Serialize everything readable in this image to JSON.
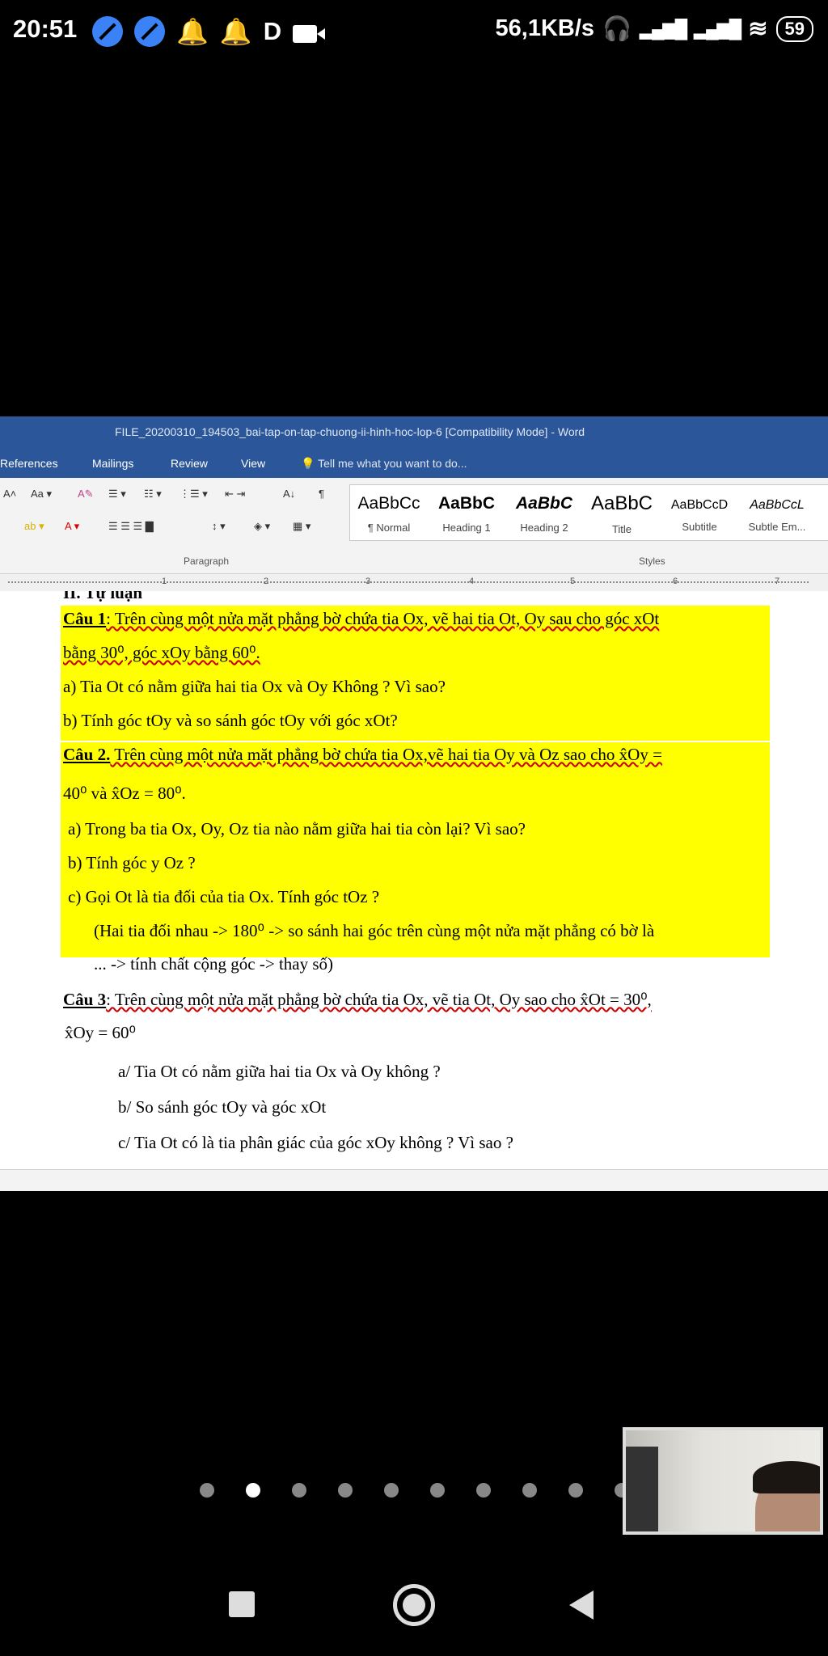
{
  "status": {
    "time": "20:51",
    "d_label": "D",
    "speed": "56,1KB/s",
    "battery": "59"
  },
  "word": {
    "title": "FILE_20200310_194503_bai-tap-on-tap-chuong-ii-hinh-hoc-lop-6 [Compatibility Mode] - Word",
    "menus": [
      "References",
      "Mailings",
      "Review",
      "View"
    ],
    "tell_me": "Tell me what you want to do...",
    "groups": {
      "paragraph": "Paragraph",
      "styles": "Styles"
    },
    "styles": [
      {
        "preview": "AaBbCc",
        "name": "¶ Normal"
      },
      {
        "preview": "AaBbC",
        "name": "Heading 1"
      },
      {
        "preview": "AaBbC",
        "name": "Heading 2"
      },
      {
        "preview": "AaBbC",
        "name": "Title"
      },
      {
        "preview": "AaBbCcD",
        "name": "Subtitle"
      },
      {
        "preview": "AaBbCcL",
        "name": "Subtle Em..."
      }
    ],
    "ruler": [
      "1",
      "2",
      "3",
      "4",
      "5",
      "6",
      "7"
    ],
    "doc": {
      "heading": "II. Tự luận",
      "q1_label": "Câu 1",
      "q1_text": ": Trên cùng một nửa mặt phẳng bờ chứa tia Ox, vẽ hai tia Ot, Oy sau cho góc xOt",
      "q1_text2": "bằng 30⁰, góc xOy bằng 60⁰.",
      "q1_a": "a) Tia Ot có nằm giữa hai tia Ox và Oy Không ? Vì sao?",
      "q1_b": "b) Tính góc tOy và so sánh góc tOy với góc xOt?",
      "q2_label": "Câu 2.",
      "q2_text": " Trên cùng một nửa mặt phẳng bờ chứa tia Ox,vẽ hai tia Oy và Oz sao cho x̂Oy =",
      "q2_text2": "40⁰ và x̂Oz = 80⁰.",
      "q2_a": "a)   Trong ba tia Ox, Oy, Oz  tia nào nằm giữa hai tia còn lại? Vì sao?",
      "q2_b": "b)   Tính  góc y Oz ?",
      "q2_c": "c)   Gọi Ot là tia đối của tia Ox. Tính góc tOz ?",
      "q2_hint": "(Hai tia đối nhau -> 180⁰ -> so sánh hai góc trên cùng một nửa mặt phẳng có bờ  là",
      "q2_hint2": "... -> tính chất cộng góc -> thay số)",
      "q3_label": "Câu 3",
      "q3_text": ":  Trên cùng một nửa mặt phẳng bờ chứa tia Ox, vẽ tia Ot, Oy sao cho  x̂Ot = 30⁰,",
      "q3_text2": "x̂Oy = 60⁰",
      "q3_a": "a/ Tia Ot có nằm giữa hai tia Ox và Oy không ?",
      "q3_b": "b/ So sánh góc tOy và góc xOt",
      "q3_c": "c/ Tia Ot có là tia phân giác của góc xOy không ? Vì sao ?"
    }
  },
  "colors": {
    "word_blue": "#2b579a",
    "highlight": "#ffff00"
  }
}
